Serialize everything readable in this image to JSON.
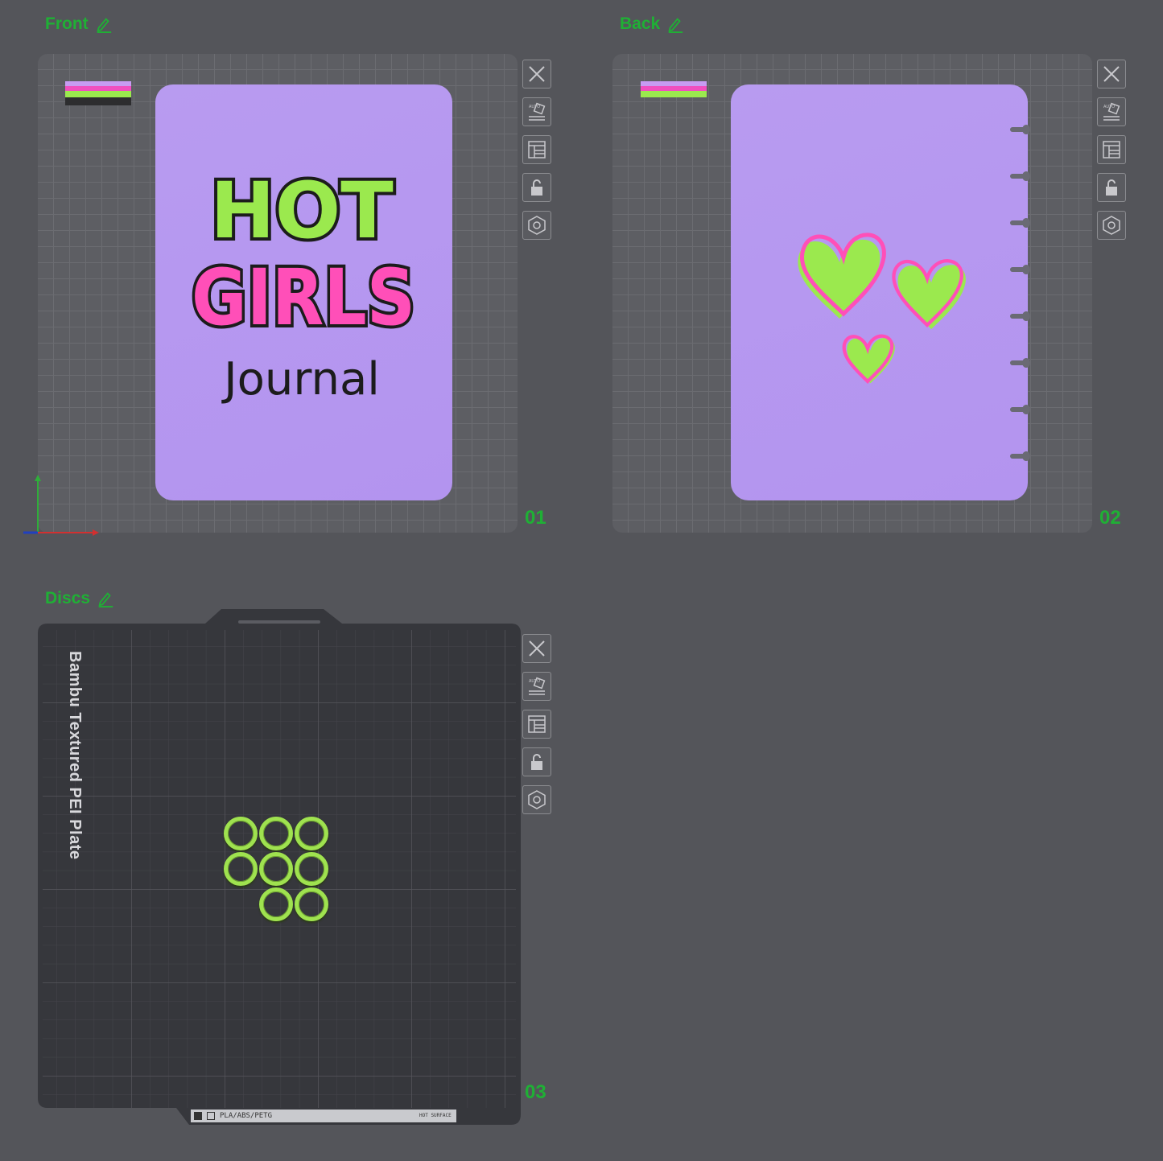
{
  "plates": [
    {
      "title": "Front",
      "number": "01"
    },
    {
      "title": "Back",
      "number": "02"
    },
    {
      "title": "Discs",
      "number": "03"
    }
  ],
  "front_cover": {
    "line1": "HOT",
    "line2": "GIRLS",
    "line3": "Journal"
  },
  "build_plate": {
    "name": "Bambu Textured PEI Plate",
    "filament_label": "PLA/ABS/PETG",
    "surface_label": "HOT SURFACE"
  },
  "toolbar_icons": [
    "close-icon",
    "auto-orient-icon",
    "arrange-icon",
    "lock-icon",
    "settings-icon"
  ],
  "colors": {
    "accent": "#1fb035",
    "cover": "#b496ef",
    "green": "#9be94e",
    "pink": "#ff4fb8"
  }
}
